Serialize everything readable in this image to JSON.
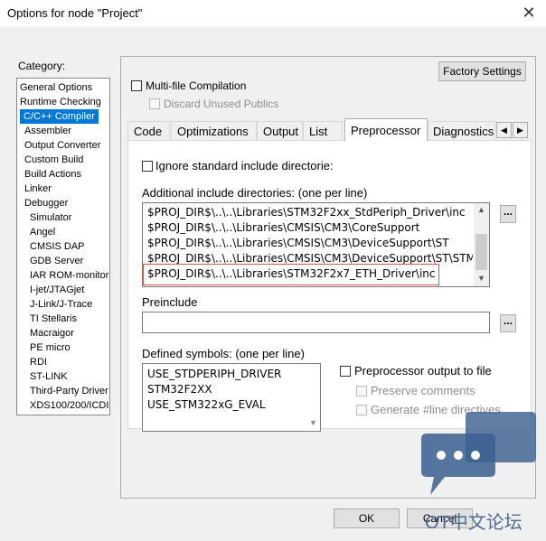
{
  "window": {
    "title": "Options for node \"Project\"",
    "close_glyph": "✕"
  },
  "category": {
    "label": "Category:",
    "items": [
      "General Options",
      "Runtime Checking",
      "C/C++ Compiler",
      "Assembler",
      "Output Converter",
      "Custom Build",
      "Build Actions",
      "Linker",
      "Debugger",
      "Simulator",
      "Angel",
      "CMSIS DAP",
      "GDB Server",
      "IAR ROM-monitor",
      "I-jet/JTAGjet",
      "J-Link/J-Trace",
      "TI Stellaris",
      "Macraigor",
      "PE micro",
      "RDI",
      "ST-LINK",
      "Third-Party Driver",
      "XDS100/200/ICDI"
    ],
    "selected": "C/C++ Compiler"
  },
  "top": {
    "factory_settings": "Factory Settings",
    "multifile": "Multi-file Compilation",
    "discard_unused": "Discard Unused Publics"
  },
  "tabs": [
    "Code",
    "Optimizations",
    "Output",
    "List",
    "Preprocessor",
    "Diagnostics"
  ],
  "active_tab": "Preprocessor",
  "preprocessor": {
    "ignore_std": "Ignore standard include directorie:",
    "include_label": "Additional include directories: (one per line)",
    "include_lines": [
      "$PROJ_DIR$\\..\\..\\Libraries\\STM32F2xx_StdPeriph_Driver\\inc",
      "$PROJ_DIR$\\..\\..\\Libraries\\CMSIS\\CM3\\CoreSupport",
      "$PROJ_DIR$\\..\\..\\Libraries\\CMSIS\\CM3\\DeviceSupport\\ST",
      "$PROJ_DIR$\\..\\..\\Libraries\\CMSIS\\CM3\\DeviceSupport\\ST\\STM",
      "$PROJ_DIR$\\..\\..\\Libraries\\STM32F2x7_ETH_Driver\\inc"
    ],
    "preinclude_label": "Preinclude",
    "preinclude_value": "",
    "defined_label": "Defined symbols: (one per line)",
    "defined_lines": [
      "USE_STDPERIPH_DRIVER",
      "STM32F2XX",
      "USE_STM322xG_EVAL"
    ],
    "pp_output": "Preprocessor output to file",
    "preserve_comments": "Preserve comments",
    "generate_line": "Generate #line directives",
    "browse": "..."
  },
  "buttons": {
    "ok": "OK",
    "cancel": "Cancel"
  },
  "watermark": "OT中文论坛",
  "colors": {
    "selection": "#0078d7",
    "highlight_box": "#d9534f",
    "watermark": "#3a5f8f"
  }
}
